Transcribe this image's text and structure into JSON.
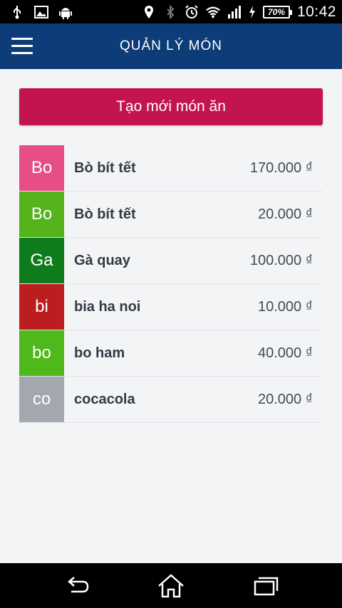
{
  "status_bar": {
    "battery_percent": "70%",
    "time": "10:42",
    "left_icons": [
      "usb-icon",
      "image-icon",
      "android-icon"
    ],
    "right_icons": [
      "location-icon",
      "bluetooth-icon",
      "alarm-icon",
      "wifi-icon",
      "signal-icon",
      "charging-icon"
    ]
  },
  "app_bar": {
    "title": "QUẢN LÝ MÓN",
    "menu_icon": "hamburger-menu-icon"
  },
  "create_button": {
    "label": "Tạo mới món ăn",
    "color": "#c3144f"
  },
  "items": [
    {
      "initials": "Bo",
      "name": "Bò bít tết",
      "price": "170.000 ₫",
      "color": "#e84e86"
    },
    {
      "initials": "Bo",
      "name": "Bò bít tết",
      "price": "20.000 ₫",
      "color": "#55b31b"
    },
    {
      "initials": "Ga",
      "name": "Gà quay",
      "price": "100.000 ₫",
      "color": "#0f7c1c"
    },
    {
      "initials": "bi",
      "name": "bia ha noi",
      "price": "10.000 ₫",
      "color": "#bc1d1f"
    },
    {
      "initials": "bo",
      "name": "bo ham",
      "price": "40.000 ₫",
      "color": "#4fb81a"
    },
    {
      "initials": "co",
      "name": "cocacola",
      "price": "20.000 ₫",
      "color": "#a3a7ae"
    }
  ],
  "nav_bar": {
    "buttons": [
      "back-icon",
      "home-icon",
      "recent-apps-icon"
    ]
  },
  "colors": {
    "app_bar": "#0d3c78",
    "background": "#f3f4f6"
  }
}
